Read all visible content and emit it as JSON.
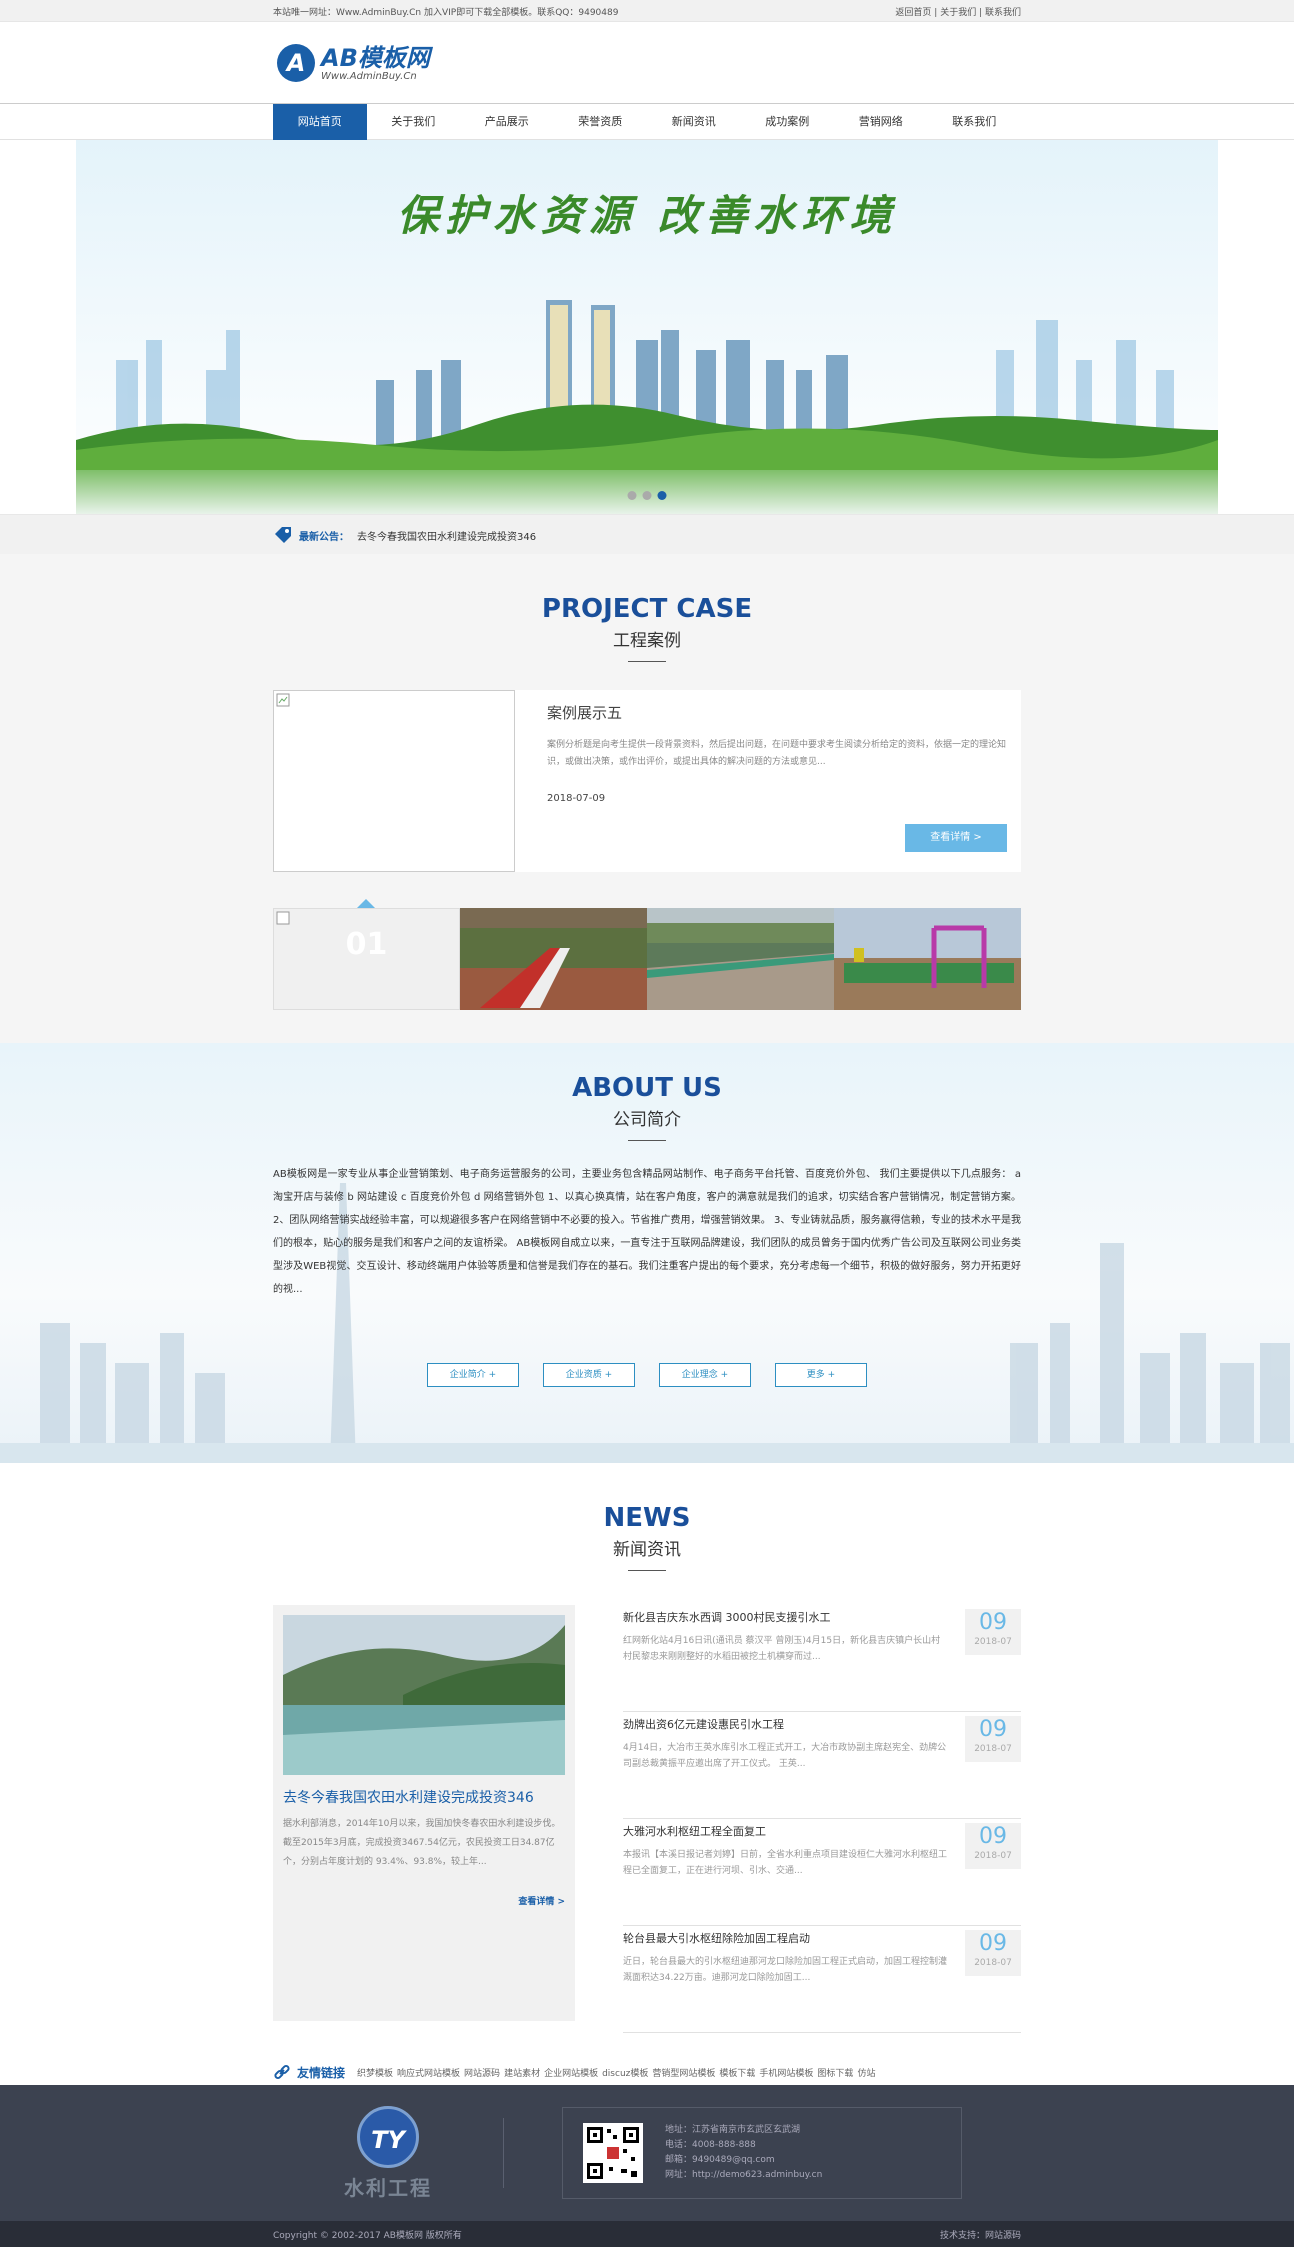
{
  "topbar": {
    "left": "本站唯一网址：Www.AdminBuy.Cn 加入VIP即可下载全部模板。联系QQ：9490489",
    "links": [
      "返回首页",
      "关于我们",
      "联系我们"
    ],
    "sep": " | "
  },
  "logo": {
    "badge": "A",
    "name": "AB模板网",
    "sub": "Www.AdminBuy.Cn"
  },
  "nav": [
    "网站首页",
    "关于我们",
    "产品展示",
    "荣誉资质",
    "新闻资讯",
    "成功案例",
    "营销网络",
    "联系我们"
  ],
  "banner": {
    "slogan": "保护水资源 改善水环境",
    "active_dot": 3,
    "dot_count": 3
  },
  "notice": {
    "label": "最新公告：",
    "text": "去冬今春我国农田水利建设完成投资346"
  },
  "case": {
    "en": "PROJECT CASE",
    "cn": "工程案例",
    "title": "案例展示五",
    "desc": "案例分析题是向考生提供一段背景资料，然后提出问题，在问题中要求考生阅读分析给定的资料，依据一定的理论知识，或做出决策，或作出评价，或提出具体的解决问题的方法或意见...",
    "date": "2018-07-09",
    "button": "查看详情 >",
    "thumb_num": "01"
  },
  "about": {
    "en": "ABOUT US",
    "cn": "公司简介",
    "text": "AB模板网是一家专业从事企业营销策划、电子商务运营服务的公司，主要业务包含精品网站制作、电子商务平台托管、百度竞价外包、 我们主要提供以下几点服务： a 淘宝开店与装修 b 网站建设 c 百度竞价外包 d 网络营销外包 1、以真心换真情，站在客户角度，客户的满意就是我们的追求，切实结合客户营销情况，制定营销方案。 2、团队网络营销实战经验丰富，可以规避很多客户在网络营销中不必要的投入。节省推广费用，增强营销效果。 3、专业铸就品质，服务赢得信赖，专业的技术水平是我们的根本，贴心的服务是我们和客户之间的友谊桥梁。 AB模板网自成立以来，一直专注于互联网品牌建设，我们团队的成员曾务于国内优秀广告公司及互联网公司业务类型涉及WEB视觉、交互设计、移动终端用户体验等质量和信誉是我们存在的基石。我们注重客户提出的每个要求，充分考虑每一个细节，积极的做好服务，努力开拓更好的视...",
    "buttons": [
      "企业简介 +",
      "企业资质 +",
      "企业理念 +",
      "更多 +"
    ]
  },
  "news": {
    "en": "NEWS",
    "cn": "新闻资讯",
    "lead": {
      "title": "去冬今春我国农田水利建设完成投资346",
      "desc": "据水利部消息，2014年10月以来，我国加快冬春农田水利建设步伐。截至2015年3月底，完成投资3467.54亿元，农民投资工日34.87亿个，分别占年度计划的 93.4%、93.8%，较上年...",
      "more": "查看详情 >"
    },
    "items": [
      {
        "title": "新化县吉庆东水西调 3000村民支援引水工",
        "desc": "红网新化站4月16日讯(通讯员 蔡汉平 曾刚玉)4月15日，新化县吉庆镇户长山村村民黎忠来刚刚整好的水稻田被挖土机横穿而过...",
        "day": "09",
        "ym": "2018-07"
      },
      {
        "title": "劲牌出资6亿元建设惠民引水工程",
        "desc": "4月14日，大冶市王英水库引水工程正式开工，大冶市政协副主席赵宪全、劲牌公司副总裁黄振平应邀出席了开工仪式。 王英...",
        "day": "09",
        "ym": "2018-07"
      },
      {
        "title": "大雅河水利枢纽工程全面复工",
        "desc": "本报讯【本溪日报记者刘婷】日前，全省水利重点项目建设桓仁大雅河水利枢纽工程已全面复工，正在进行河坝、引水、交通...",
        "day": "09",
        "ym": "2018-07"
      },
      {
        "title": "轮台县最大引水枢纽除险加固工程启动",
        "desc": "近日，轮台县最大的引水枢纽迪那河龙口除险加固工程正式启动，加固工程控制灌溉面积达34.22万亩。迪那河龙口除险加固工...",
        "day": "09",
        "ym": "2018-07"
      }
    ]
  },
  "friend": {
    "label": "友情链接",
    "links": [
      "织梦模板",
      "响应式网站模板",
      "网站源码",
      "建站素材",
      "企业网站模板",
      "discuz模板",
      "营销型网站模板",
      "模板下载",
      "手机网站模板",
      "图标下载",
      "仿站"
    ]
  },
  "footer": {
    "logo_mark": "TY",
    "logo_name": "水利工程",
    "address": "地址：江苏省南京市玄武区玄武湖",
    "phone": "电话：4008-888-888",
    "email": "邮箱：9490489@qq.com",
    "site": "网址：http://demo623.adminbuy.cn"
  },
  "copyright": {
    "left": "Copyright © 2002-2017 AB模板网 版权所有",
    "right": "技术支持：网站源码"
  },
  "colors": {
    "primary": "#1a5fa8",
    "accent": "#69b8e6",
    "footer": "#3c4250"
  }
}
